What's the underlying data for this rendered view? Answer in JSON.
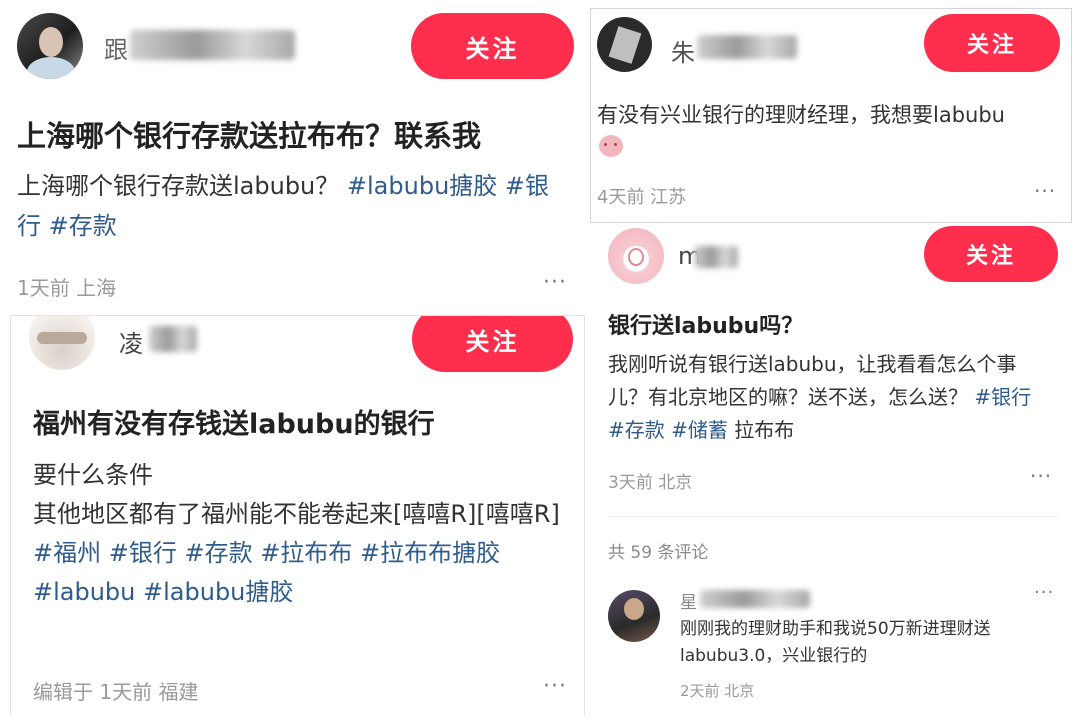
{
  "follow_label": "关注",
  "more_label": "···",
  "post1": {
    "author": "跟",
    "title": "上海哪个银行存款送拉布布？联系我",
    "body": "上海哪个银行存款送labubu？",
    "tags": [
      "#labubu搪胶",
      "#银行",
      "#存款"
    ],
    "meta": "1天前 上海"
  },
  "post2": {
    "author": "凌",
    "title": "福州有没有存钱送labubu的银行",
    "line1": "要什么条件",
    "line2": "其他地区都有了福州能不能卷起来[嘻嘻R][嘻嘻R]",
    "tags": [
      "#福州",
      "#银行",
      "#存款",
      "#拉布布",
      "#拉布布搪胶",
      "#labubu",
      "#labubu搪胶"
    ],
    "meta": "编辑于 1天前 福建"
  },
  "post3": {
    "author": "朱",
    "body": "有没有兴业银行的理财经理，我想要labubu",
    "meta": "4天前 江苏"
  },
  "post4": {
    "author": "m",
    "title": "银行送labubu吗？",
    "body": "我刚听说有银行送labubu，让我看看怎么个事儿？有北京地区的嘛？送不送，怎么送？",
    "tags": [
      "#银行",
      "#存款",
      "#储蓄"
    ],
    "tail": "拉布布",
    "meta": "3天前 北京",
    "comment_count": "共 59 条评论"
  },
  "comment": {
    "author": "星",
    "text": "刚刚我的理财助手和我说50万新进理财送labubu3.0，兴业银行的",
    "meta": "2天前 北京"
  }
}
